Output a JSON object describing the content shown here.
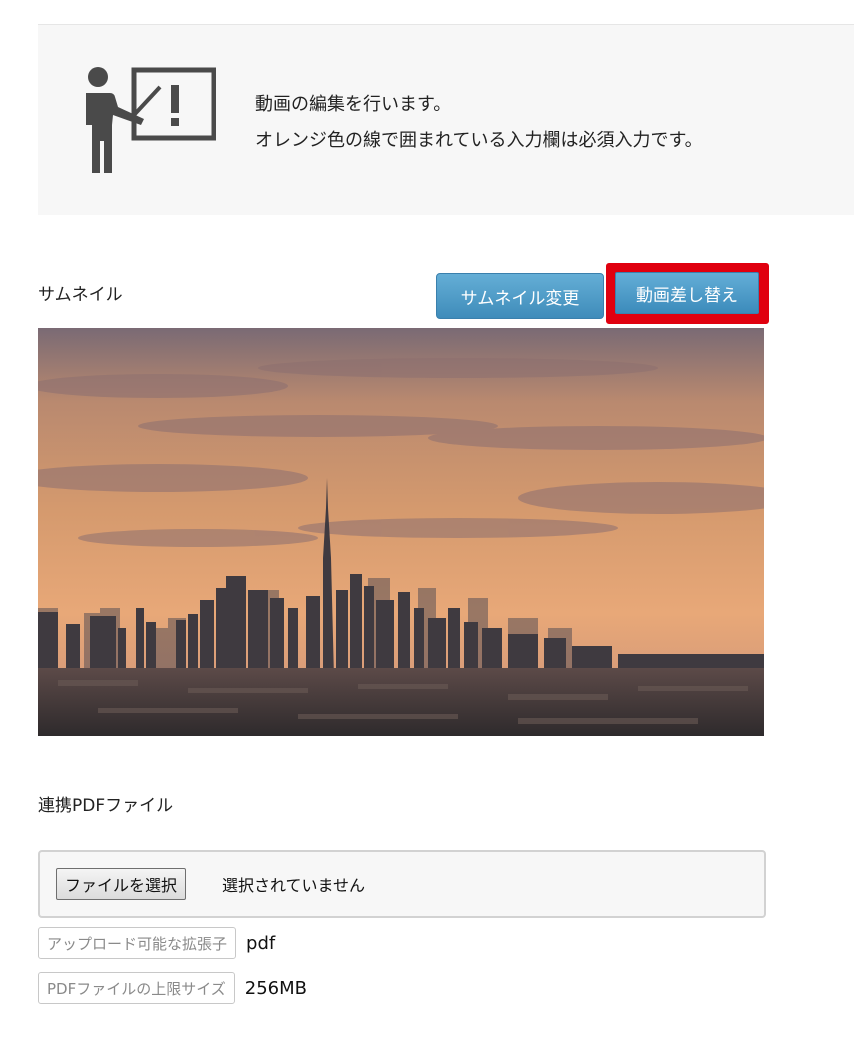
{
  "notice": {
    "line1": "動画の編集を行います。",
    "line2": "オレンジ色の線で囲まれている入力欄は必須入力です。",
    "icon": "presenter-board-icon"
  },
  "thumbnail": {
    "label": "サムネイル",
    "change_button": "サムネイル変更",
    "replace_button": "動画差し替え",
    "image": "city-skyline-sunset"
  },
  "pdf": {
    "label": "連携PDFファイル",
    "choose_button": "ファイルを選択",
    "status": "選択されていません",
    "ext_label": "アップロード可能な拡張子",
    "ext_value": "pdf",
    "size_label": "PDFファイルの上限サイズ",
    "size_value": "256MB"
  },
  "colors": {
    "button_blue": "#4a97c4",
    "highlight_red": "#e0000f",
    "notice_bg": "#f7f7f7"
  }
}
